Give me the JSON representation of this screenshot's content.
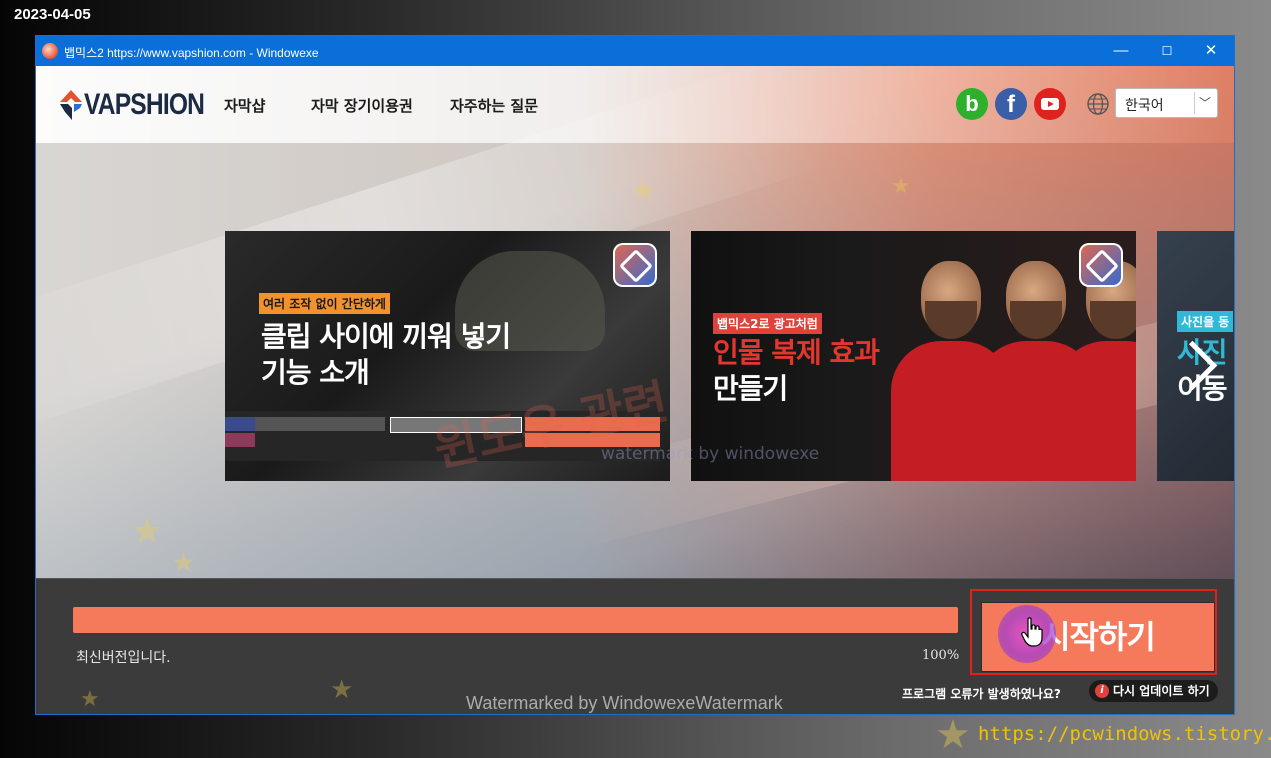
{
  "capture_date": "2023-04-05",
  "window": {
    "title": "뱁믹스2  https://www.vapshion.com  - Windowexe",
    "controls": {
      "minimize": "—",
      "maximize": "☐",
      "close": "✕"
    }
  },
  "header": {
    "logo_text": "VAPSHION",
    "nav": [
      {
        "label": "자막샵"
      },
      {
        "label": "자막 장기이용권"
      },
      {
        "label": "자주하는 질문"
      }
    ],
    "social": {
      "blog": "b",
      "facebook": "f",
      "youtube": "youtube-icon"
    },
    "language": {
      "selected": "한국어"
    }
  },
  "carousel": {
    "cards": [
      {
        "tag": "여러 조작 없이 간단하게",
        "title_line1": "클립 사이에 끼워 넣기",
        "title_line2": "기능 소개"
      },
      {
        "tag": "뱁믹스2로 광고처럼",
        "title_line1": "인물 복제 효과",
        "title_line2": "만들기"
      },
      {
        "tag": "사진을 동",
        "title_line1": "사진",
        "title_line2": "이동"
      }
    ],
    "overlay_watermark": "watermark by windowexe",
    "overlay_watermark_big": "윈도우 관련"
  },
  "footer": {
    "progress_percent": 100,
    "progress_label": "100%",
    "status_text": "최신버전입니다.",
    "start_button_label": "시작하기",
    "error_question": "프로그램 오류가 발생하였나요?",
    "update_again_label": "다시 업데이트 하기",
    "update_icon": "i",
    "watermark": "Watermarked by WindowexeWatermark"
  },
  "site_url": "https://pcwindows.tistory.com",
  "colors": {
    "accent": "#f57a5c",
    "titlebar": "#0a6fd8",
    "highlight_frame": "#e0201c",
    "url_text": "#f2c200"
  }
}
